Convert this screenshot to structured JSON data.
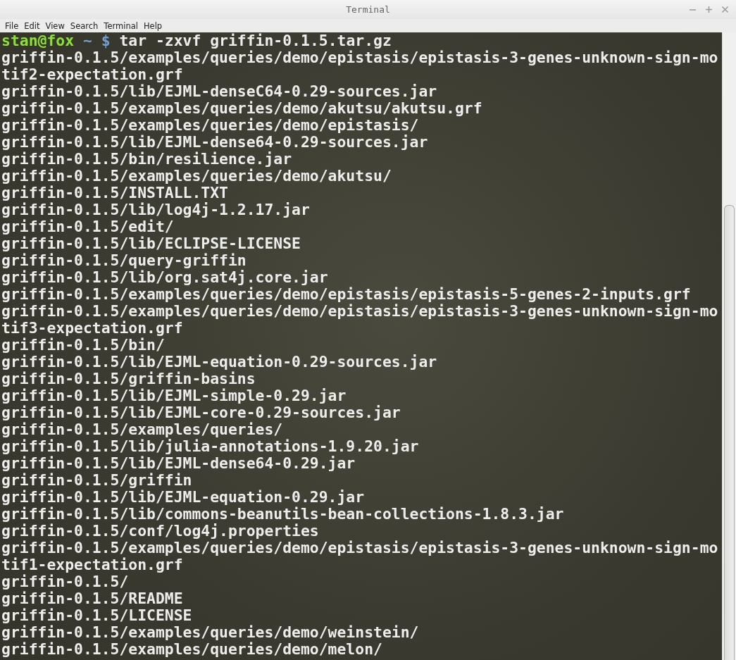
{
  "window": {
    "title": "Terminal"
  },
  "menu": [
    "File",
    "Edit",
    "View",
    "Search",
    "Terminal",
    "Help"
  ],
  "prompt": {
    "user_host": "stan@fox",
    "path": "~",
    "symbol": "$",
    "command": "tar -zxvf griffin-0.1.5.tar.gz"
  },
  "output": [
    "griffin-0.1.5/examples/queries/demo/epistasis/epistasis-3-genes-unknown-sign-motif2-expectation.grf",
    "griffin-0.1.5/lib/EJML-denseC64-0.29-sources.jar",
    "griffin-0.1.5/examples/queries/demo/akutsu/akutsu.grf",
    "griffin-0.1.5/examples/queries/demo/epistasis/",
    "griffin-0.1.5/lib/EJML-dense64-0.29-sources.jar",
    "griffin-0.1.5/bin/resilience.jar",
    "griffin-0.1.5/examples/queries/demo/akutsu/",
    "griffin-0.1.5/INSTALL.TXT",
    "griffin-0.1.5/lib/log4j-1.2.17.jar",
    "griffin-0.1.5/edit/",
    "griffin-0.1.5/lib/ECLIPSE-LICENSE",
    "griffin-0.1.5/query-griffin",
    "griffin-0.1.5/lib/org.sat4j.core.jar",
    "griffin-0.1.5/examples/queries/demo/epistasis/epistasis-5-genes-2-inputs.grf",
    "griffin-0.1.5/examples/queries/demo/epistasis/epistasis-3-genes-unknown-sign-motif3-expectation.grf",
    "griffin-0.1.5/bin/",
    "griffin-0.1.5/lib/EJML-equation-0.29-sources.jar",
    "griffin-0.1.5/griffin-basins",
    "griffin-0.1.5/lib/EJML-simple-0.29.jar",
    "griffin-0.1.5/lib/EJML-core-0.29-sources.jar",
    "griffin-0.1.5/examples/queries/",
    "griffin-0.1.5/lib/julia-annotations-1.9.20.jar",
    "griffin-0.1.5/lib/EJML-dense64-0.29.jar",
    "griffin-0.1.5/griffin",
    "griffin-0.1.5/lib/EJML-equation-0.29.jar",
    "griffin-0.1.5/lib/commons-beanutils-bean-collections-1.8.3.jar",
    "griffin-0.1.5/conf/log4j.properties",
    "griffin-0.1.5/examples/queries/demo/epistasis/epistasis-3-genes-unknown-sign-motif1-expectation.grf",
    "griffin-0.1.5/",
    "griffin-0.1.5/README",
    "griffin-0.1.5/LICENSE",
    "griffin-0.1.5/examples/queries/demo/weinstein/",
    "griffin-0.1.5/examples/queries/demo/melon/"
  ]
}
